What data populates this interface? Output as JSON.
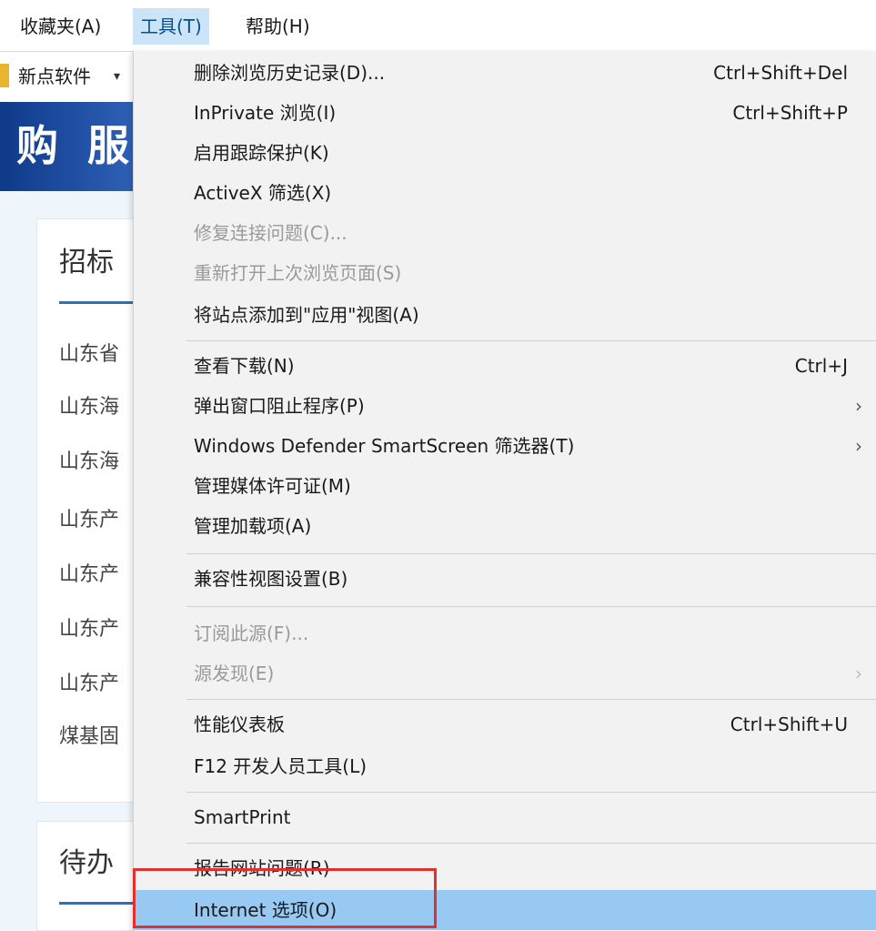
{
  "menubar": {
    "favorites": "收藏夹(A)",
    "tools": "工具(T)",
    "help": "帮助(H)"
  },
  "favbar": {
    "item": "新点软件",
    "arrow": "▾"
  },
  "page": {
    "banner_text": "购 服",
    "card1_title": "招标",
    "card1_rows": [
      "山东省",
      "山东海",
      "山东海",
      "山东产",
      "山东产",
      "山东产",
      "山东产",
      "煤基固"
    ],
    "card2_title": "待办"
  },
  "tools_menu": [
    {
      "label": "删除浏览历史记录(D)...",
      "shortcut": "Ctrl+Shift+Del"
    },
    {
      "label": "InPrivate 浏览(I)",
      "shortcut": "Ctrl+Shift+P"
    },
    {
      "label": "启用跟踪保护(K)"
    },
    {
      "label": "ActiveX 筛选(X)"
    },
    {
      "label": "修复连接问题(C)...",
      "disabled": true
    },
    {
      "label": "重新打开上次浏览页面(S)",
      "disabled": true
    },
    {
      "label": "将站点添加到\"应用\"视图(A)"
    },
    {
      "label": "查看下载(N)",
      "shortcut": "Ctrl+J"
    },
    {
      "label": "弹出窗口阻止程序(P)",
      "submenu": "›"
    },
    {
      "label": "Windows Defender SmartScreen 筛选器(T)",
      "submenu": "›"
    },
    {
      "label": "管理媒体许可证(M)"
    },
    {
      "label": "管理加载项(A)"
    },
    {
      "label": "兼容性视图设置(B)"
    },
    {
      "label": "订阅此源(F)...",
      "disabled": true
    },
    {
      "label": "源发现(E)",
      "disabled": true,
      "submenu": "›"
    },
    {
      "label": "性能仪表板",
      "shortcut": "Ctrl+Shift+U"
    },
    {
      "label": "F12 开发人员工具(L)"
    },
    {
      "label": "SmartPrint"
    },
    {
      "label": "报告网站问题(R)"
    },
    {
      "label": "Internet 选项(O)",
      "highlighted": true
    }
  ],
  "colors": {
    "highlight": "#98c9f2",
    "active_menu": "#cce4f7",
    "annotation_box": "#e0312f",
    "banner": "#1a4a9c"
  }
}
